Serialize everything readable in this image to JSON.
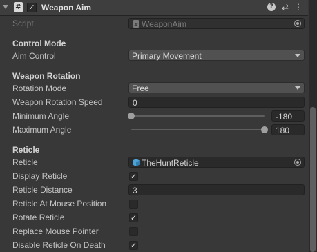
{
  "header": {
    "title": "Weapon Aim",
    "enabled_check": "✓",
    "script_glyph": "#",
    "help_glyph": "?",
    "presets_glyph": "⇄",
    "menu_glyph": "⋮"
  },
  "script_row": {
    "label": "Script",
    "value": "WeaponAim"
  },
  "control_mode": {
    "heading": "Control Mode",
    "aim_control_label": "Aim Control",
    "aim_control_value": "Primary Movement"
  },
  "weapon_rotation": {
    "heading": "Weapon Rotation",
    "rotation_mode_label": "Rotation Mode",
    "rotation_mode_value": "Free",
    "speed_label": "Weapon Rotation Speed",
    "speed_value": "0",
    "min_angle_label": "Minimum Angle",
    "min_angle_value": "-180",
    "min_angle_fraction": 0.0,
    "max_angle_label": "Maximum Angle",
    "max_angle_value": "180",
    "max_angle_fraction": 1.0
  },
  "reticle": {
    "heading": "Reticle",
    "reticle_label": "Reticle",
    "reticle_value": "TheHuntReticle",
    "display_label": "Display Reticle",
    "display_checked": "✓",
    "distance_label": "Reticle Distance",
    "distance_value": "3",
    "at_mouse_label": "Reticle At Mouse Position",
    "at_mouse_checked": "",
    "rotate_label": "Rotate Reticle",
    "rotate_checked": "✓",
    "replace_pointer_label": "Replace Mouse Pointer",
    "replace_pointer_checked": "",
    "disable_on_death_label": "Disable Reticle On Death",
    "disable_on_death_checked": "✓"
  },
  "colors": {
    "panel_bg": "#383838",
    "header_bg": "#3e3e3e",
    "field_bg": "#2a2a2a",
    "dropdown_bg": "#515151",
    "text": "#c4c4c4",
    "reticle_icon": "#4da3d6"
  },
  "icons": [
    "fold-arrow-icon",
    "script-icon",
    "help-icon",
    "presets-icon",
    "kebab-menu-icon",
    "object-picker-icon",
    "prefab-icon"
  ]
}
